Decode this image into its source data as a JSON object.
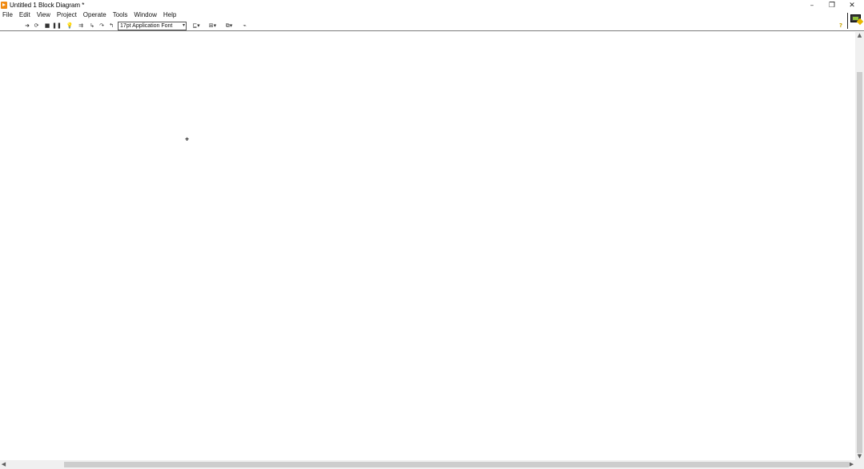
{
  "window": {
    "title": "Untitled 1 Block Diagram *",
    "controls": {
      "minimize": "–",
      "maximize": "❐",
      "close": "✕"
    }
  },
  "menu": [
    "File",
    "Edit",
    "View",
    "Project",
    "Operate",
    "Tools",
    "Window",
    "Help"
  ],
  "toolbar": {
    "run": "➜",
    "run_continuously": "⟳",
    "abort": "■",
    "pause": "❚❚",
    "highlight_execution": "💡",
    "retain_wire_values": "⇉",
    "step_into": "↳",
    "step_over": "↷",
    "step_out": "↰",
    "font_select": "17pt Application Font",
    "font_dropdown": "▾",
    "align_objects": "⊑▾",
    "distribute_objects": "⊞▾",
    "reorder": "⧉▾",
    "clean_up": "⌁",
    "help": "?"
  },
  "canvas": {
    "cursor": "⌖"
  },
  "scrollbars": {
    "up": "▲",
    "down": "▼",
    "left": "◀",
    "right": "▶"
  },
  "colors": {
    "app_icon": "#f08a12",
    "help_icon": "#c5a100",
    "scroll_thumb": "#cdcdcd"
  }
}
